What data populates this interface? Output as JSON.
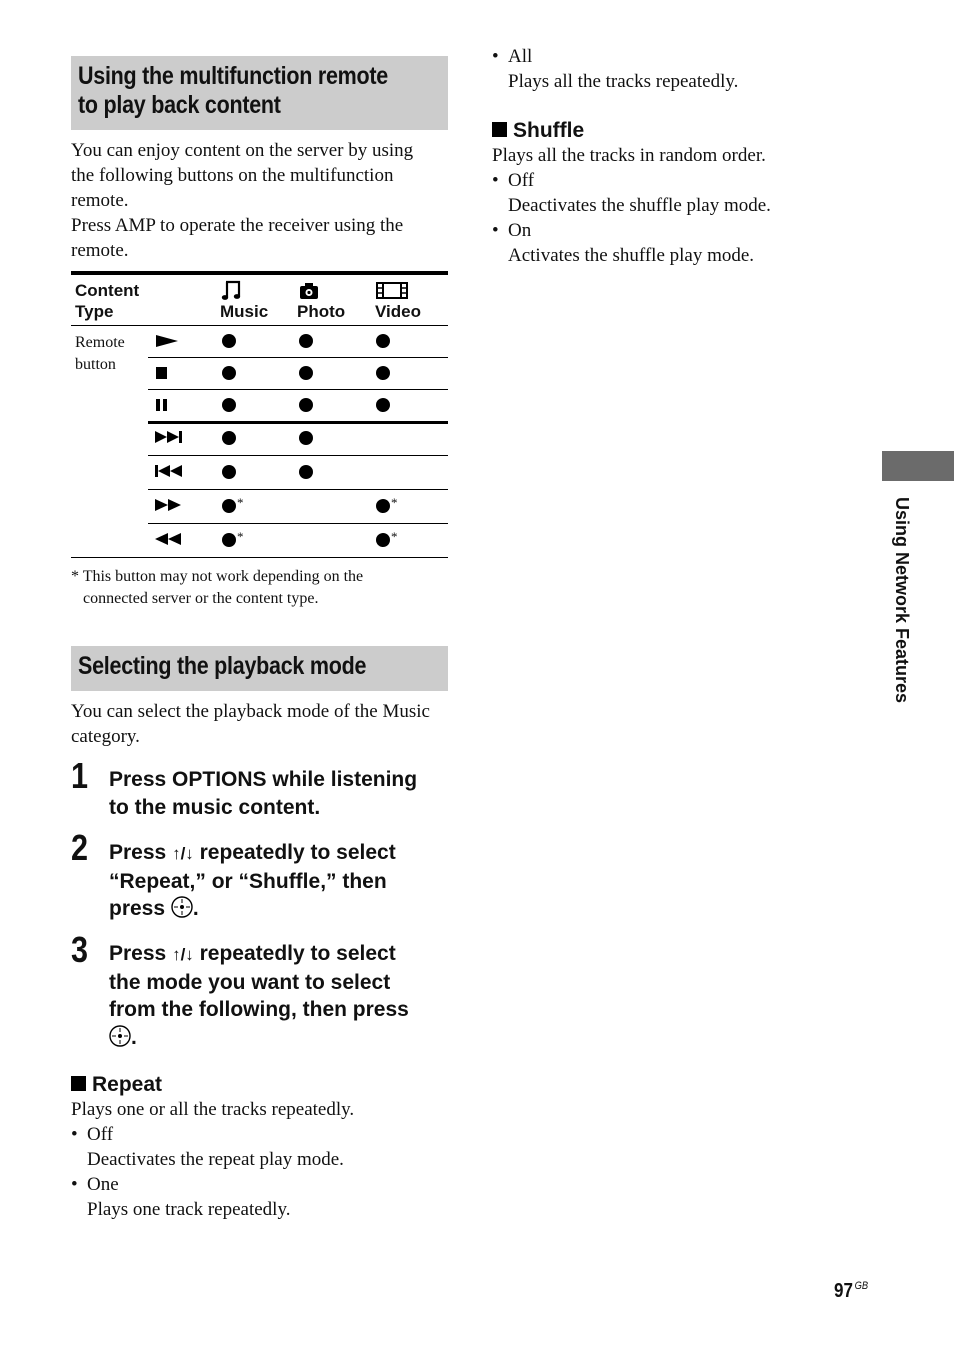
{
  "section1": {
    "title_line1": "Using the multifunction remote",
    "title_line2": "to play back content",
    "intro": [
      "You can enjoy content on the server by using",
      "the following buttons on the multifunction",
      "remote.",
      "Press AMP to operate the receiver using the",
      "remote."
    ],
    "table": {
      "header_label_line1": "Content",
      "header_label_line2": "Type",
      "columns": [
        {
          "label": "Music",
          "icon": "music-note-icon"
        },
        {
          "label": "Photo",
          "icon": "camera-icon"
        },
        {
          "label": "Video",
          "icon": "film-icon"
        }
      ],
      "row_label_line1": "Remote",
      "row_label_line2": "button",
      "rows": [
        {
          "button": "play-icon",
          "music": "●",
          "photo": "●",
          "video": "●"
        },
        {
          "button": "stop-icon",
          "music": "●",
          "photo": "●",
          "video": "●"
        },
        {
          "button": "pause-icon",
          "music": "●",
          "photo": "●",
          "video": "●"
        },
        {
          "button": "next-track-icon",
          "music": "●",
          "photo": "●",
          "video": ""
        },
        {
          "button": "previous-track-icon",
          "music": "●",
          "photo": "●",
          "video": ""
        },
        {
          "button": "fast-forward-icon",
          "music": "●*",
          "photo": "",
          "video": "●*"
        },
        {
          "button": "rewind-icon",
          "music": "●*",
          "photo": "",
          "video": "●*"
        }
      ],
      "asterisk": "*"
    },
    "footnote_line1": "* This button may not work depending on the",
    "footnote_line2": "connected server or the content type."
  },
  "section2": {
    "title": "Selecting the playback mode",
    "intro": [
      "You can select the playback mode of the Music",
      "category."
    ],
    "steps": [
      {
        "number": "1",
        "lines": [
          "Press OPTIONS while listening",
          "to the music content."
        ]
      },
      {
        "number": "2",
        "lines": [
          "Press ↑/↓ repeatedly to select",
          "“Repeat,” or “Shuffle,” then",
          "press",
          "."
        ]
      },
      {
        "number": "3",
        "lines": [
          "Press ↑/↓ repeatedly to select",
          "the mode you want to select",
          "from the following, then press",
          "."
        ]
      }
    ],
    "step_prefix": "Press ",
    "step_arrows": "↑/↓",
    "step2_line1_rest": " repeatedly to select",
    "step2_line2": "“Repeat,” or “Shuffle,” then",
    "step2_line3": "press ",
    "step3_line2": "the mode you want to select",
    "step3_line3": "from the following, then press",
    "period": "."
  },
  "repeat": {
    "title": "Repeat",
    "desc": "Plays one or all the tracks repeatedly.",
    "options": [
      {
        "name": "Off",
        "desc": "Deactivates the repeat play mode."
      },
      {
        "name": "One",
        "desc": "Plays one track repeatedly."
      },
      {
        "name": "All",
        "desc": "Plays all the tracks repeatedly."
      }
    ]
  },
  "shuffle": {
    "title": "Shuffle",
    "desc": "Plays all the tracks in random order.",
    "options": [
      {
        "name": "Off",
        "desc": "Deactivates the shuffle play mode."
      },
      {
        "name": "On",
        "desc": "Activates the shuffle play mode."
      }
    ]
  },
  "side_tab": {
    "label": "Using Network Features",
    "color": "#6b6b6b"
  },
  "page": {
    "number": "97",
    "suffix": "GB"
  },
  "colors": {
    "heading_bg": "#cccccc",
    "text": "#111111"
  }
}
